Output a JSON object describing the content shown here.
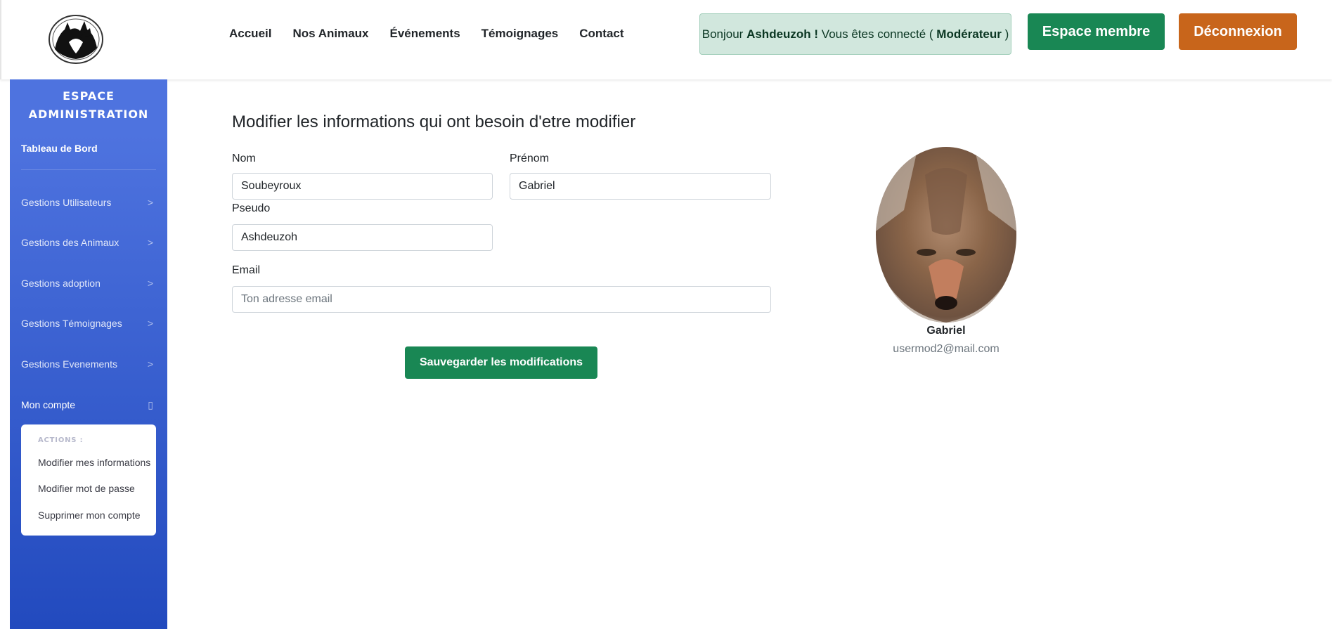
{
  "header": {
    "nav": [
      "Accueil",
      "Nos Animaux",
      "Événements",
      "Témoignages",
      "Contact"
    ],
    "greeting": {
      "prefix": "Bonjour ",
      "user": "Ashdeuzoh",
      "middle": " ! Vous êtes connecté ( ",
      "role": "Modérateur",
      "suffix": " )"
    },
    "member_button": "Espace membre",
    "logout_button": "Déconnexion"
  },
  "sidebar": {
    "title_line1": "ESPACE",
    "title_line2": "ADMINISTRATION",
    "dashboard": "Tableau de Bord",
    "items": [
      {
        "label": "Gestions Utilisateurs",
        "chevron": ">"
      },
      {
        "label": "Gestions des Animaux",
        "chevron": ">"
      },
      {
        "label": "Gestions adoption",
        "chevron": ">"
      },
      {
        "label": "Gestions Témoignages",
        "chevron": ">"
      },
      {
        "label": "Gestions Evenements",
        "chevron": ">"
      },
      {
        "label": "Mon compte",
        "chevron": "▯"
      }
    ],
    "actions_header": "ACTIONS :",
    "actions": [
      "Modifier mes informations",
      "Modifier mot de passe",
      "Supprimer mon compte"
    ]
  },
  "form": {
    "title": "Modifier les informations qui ont besoin d'etre modifier",
    "nom_label": "Nom",
    "nom_value": "Soubeyroux",
    "prenom_label": "Prénom",
    "prenom_value": "Gabriel",
    "pseudo_label": "Pseudo",
    "pseudo_value": "Ashdeuzoh",
    "email_label": "Email",
    "email_value": "",
    "email_placeholder": "Ton adresse email",
    "save_button": "Sauvegarder les modifications"
  },
  "profile": {
    "name": "Gabriel",
    "email": "usermod2@mail.com"
  },
  "colors": {
    "sidebar_top": "#4e73df",
    "sidebar_bottom": "#224abe",
    "success": "#198754",
    "logout": "#c8651b",
    "greeting_bg": "#d1e7dd"
  }
}
